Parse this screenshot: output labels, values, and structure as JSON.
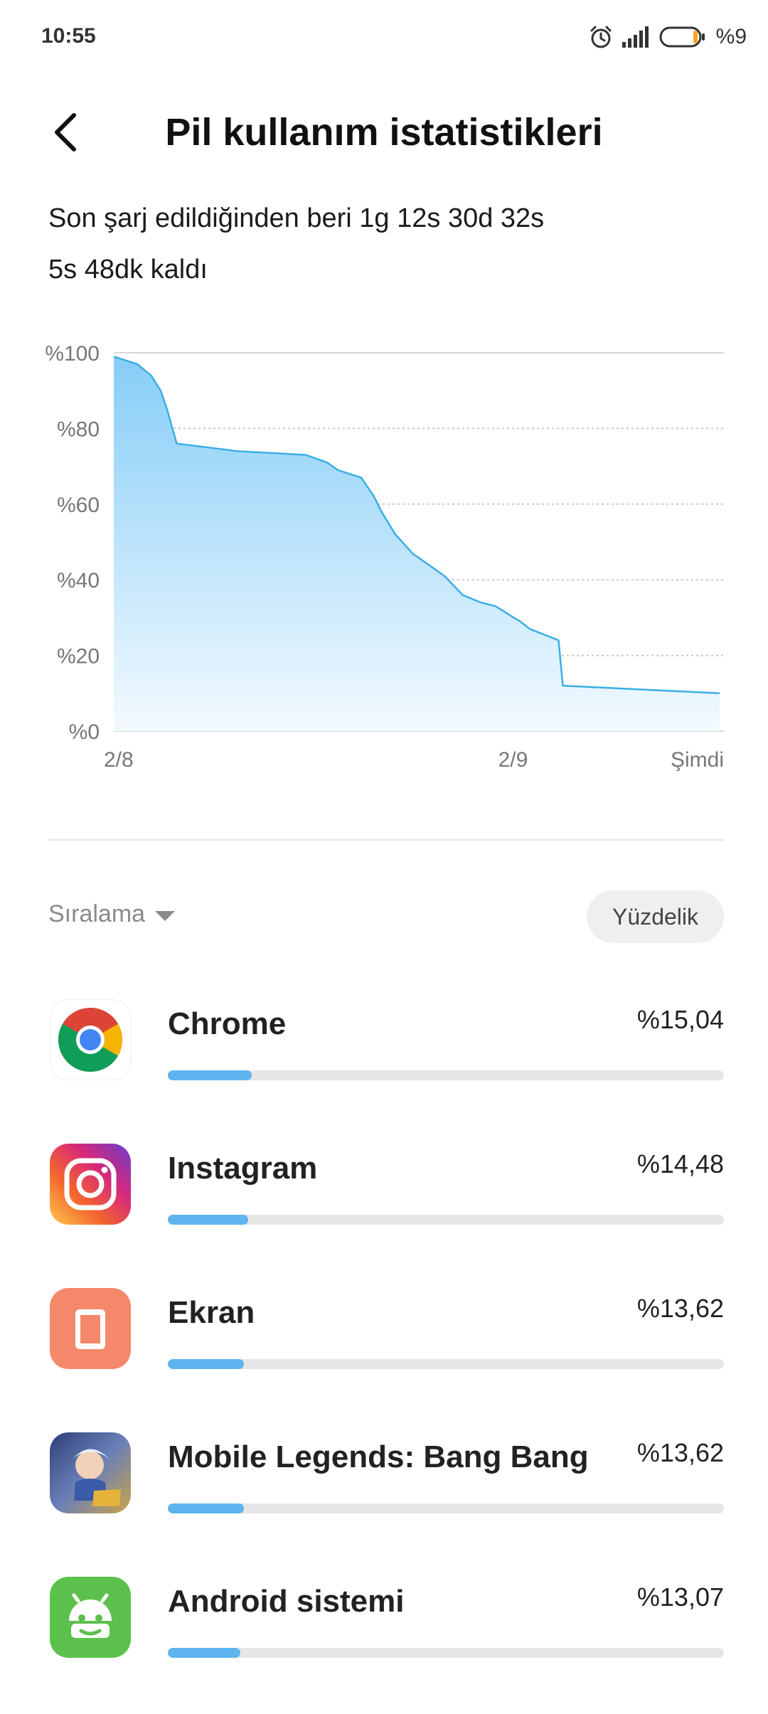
{
  "status_bar": {
    "time": "10:55",
    "battery_text": "%9"
  },
  "header": {
    "title": "Pil kullanım istatistikleri"
  },
  "summary": {
    "since_charge": "Son şarj edildiğinden beri 1g 12s 30d 32s",
    "remaining": "5s 48dk kaldı"
  },
  "chart_data": {
    "type": "area",
    "title": "",
    "xlabel": "",
    "ylabel": "",
    "y_ticks": [
      "%100",
      "%80",
      "%60",
      "%40",
      "%20",
      "%0"
    ],
    "ylim": [
      0,
      100
    ],
    "x_tick_labels": [
      "2/8",
      "2/9",
      "Şimdi"
    ],
    "x_tick_positions": [
      0,
      0.6544,
      1
    ],
    "grid": true,
    "series": [
      {
        "x": [
          0,
          0.0385,
          0.0612,
          0.0769,
          0.0874,
          0.1031,
          0.2028,
          0.3147,
          0.3497,
          0.3671,
          0.4056,
          0.4266,
          0.4388,
          0.4615,
          0.4895,
          0.5157,
          0.542,
          0.5717,
          0.6014,
          0.6259,
          0.6556,
          0.6661,
          0.6818,
          0.6975,
          0.729,
          0.736,
          0.993
        ],
        "values": [
          99,
          97,
          94,
          90,
          85,
          76,
          74,
          73,
          71,
          69,
          67,
          62,
          58,
          52,
          47,
          44,
          41,
          36,
          34,
          33,
          30,
          29,
          27,
          26,
          24,
          12,
          10
        ]
      }
    ],
    "colors": {
      "line": "#3aaee6",
      "fill_top": "#86cdf7",
      "fill_bottom": "#f3faff",
      "grid": "#c8c8c8"
    }
  },
  "sort": {
    "label": "Sıralama",
    "mode_label": "Yüzdelik"
  },
  "apps": [
    {
      "name": "Chrome",
      "percent_text": "%15,04",
      "fraction": 0.1504,
      "icon": "chrome-icon"
    },
    {
      "name": "Instagram",
      "percent_text": "%14,48",
      "fraction": 0.1448,
      "icon": "instagram-icon"
    },
    {
      "name": "Ekran",
      "percent_text": "%13,62",
      "fraction": 0.1362,
      "icon": "screen-icon"
    },
    {
      "name": "Mobile Legends: Bang Bang",
      "percent_text": "%13,62",
      "fraction": 0.1362,
      "icon": "mobile-legends-icon"
    },
    {
      "name": "Android sistemi",
      "percent_text": "%13,07",
      "fraction": 0.1307,
      "icon": "android-icon"
    }
  ]
}
